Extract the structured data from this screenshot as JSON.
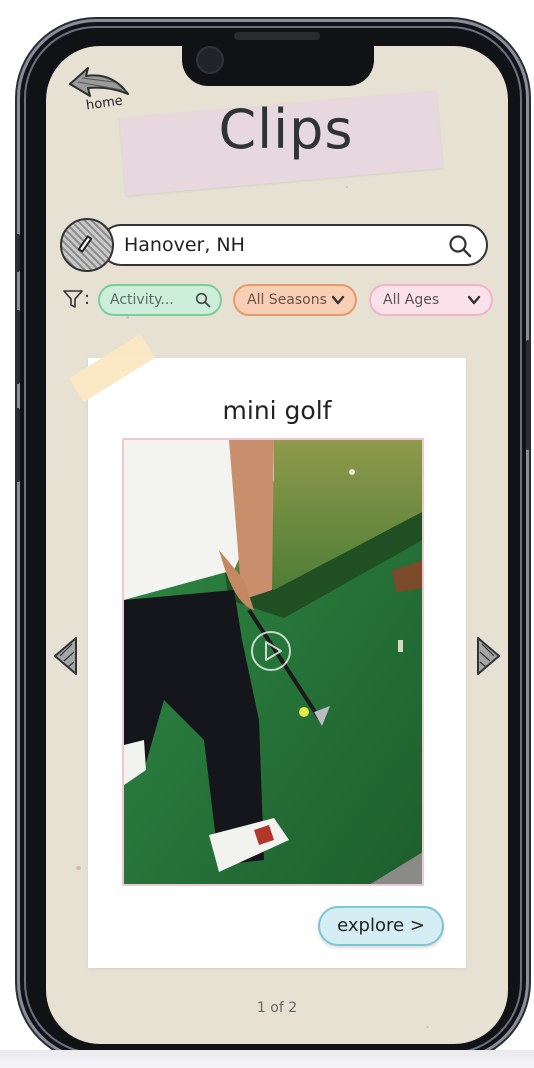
{
  "header": {
    "home_label": "home",
    "title": "Clips"
  },
  "search": {
    "value": "Hanover, NH"
  },
  "filters": {
    "activity": "Activity...",
    "season": "All Seasons",
    "ages": "All Ages",
    "colon": ":"
  },
  "card": {
    "title": "mini golf",
    "explore_label": "explore >"
  },
  "pager": {
    "text": "1 of 2"
  },
  "colors": {
    "paper": "#e6e1d2",
    "title_tape": "#e6d8de",
    "activity_pill": "#cdeed9",
    "season_pill": "#f8cfb4",
    "ages_pill": "#fbe1ea",
    "explore_button": "#d4eef3",
    "corner_tape": "#fbe8c3"
  },
  "icons": {
    "home": "curved-back-arrow-icon",
    "location": "diamond-location-icon",
    "search": "search-icon",
    "filter": "funnel-icon",
    "dropdown": "chevron-down-icon",
    "play": "play-icon",
    "prev": "triangle-left-icon",
    "next": "triangle-right-icon"
  }
}
